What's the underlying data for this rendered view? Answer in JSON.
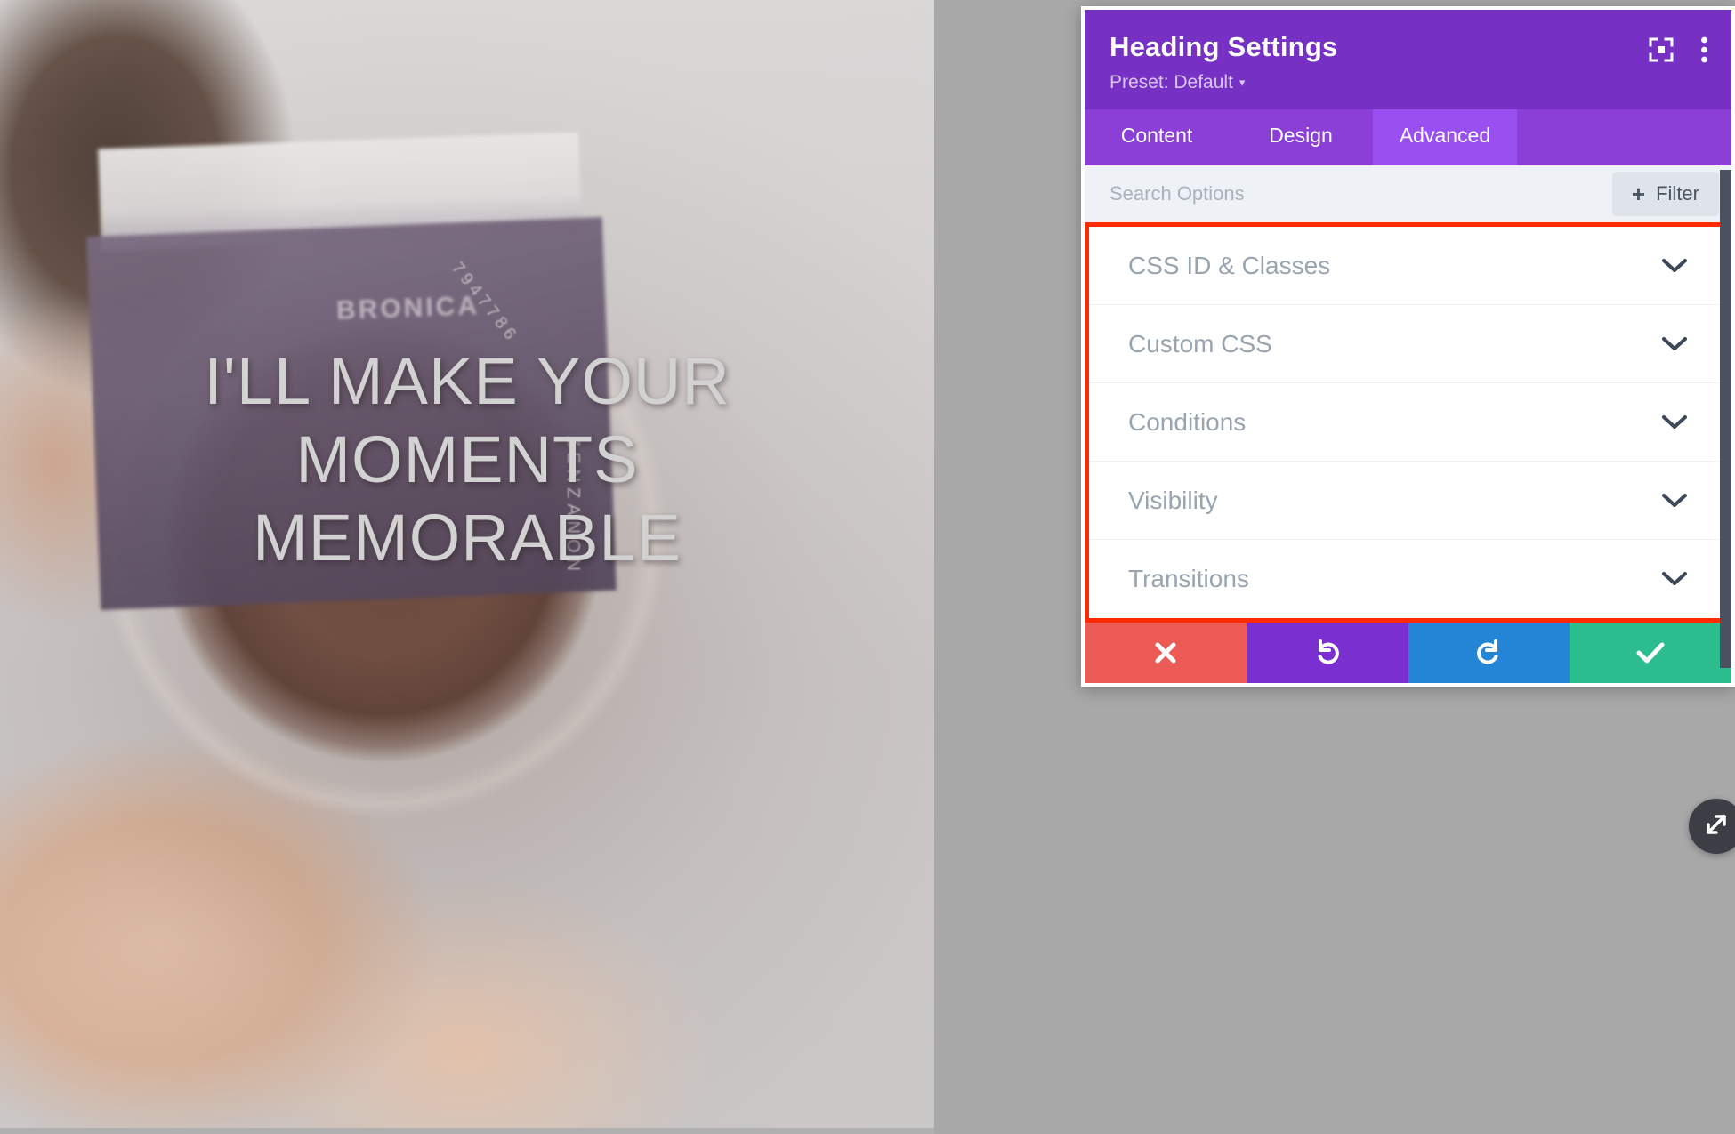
{
  "hero": {
    "heading_line1": "I'LL MAKE YOUR",
    "heading_line2": "MOMENTS",
    "heading_line3": "MEMORABLE",
    "camera_brand_text": "BRONICA",
    "lens_serial": "7947786",
    "lens_brand": "ZENZANON",
    "heading_color": "#d2d2d2"
  },
  "modal": {
    "title": "Heading Settings",
    "preset_label": "Preset: Default",
    "preset_caret": "▾",
    "header_icons": [
      {
        "name": "focus-target-icon"
      },
      {
        "name": "more-vertical-icon"
      }
    ],
    "header_bg": "#7630c3",
    "tabs": [
      {
        "label": "Content",
        "active": false
      },
      {
        "label": "Design",
        "active": false
      },
      {
        "label": "Advanced",
        "active": true
      }
    ],
    "tab_bg": "#8b3fd6",
    "tab_active_bg": "#9a4ff0",
    "search": {
      "value": "",
      "placeholder": "Search Options",
      "filter_label": "Filter",
      "filter_plus": "+"
    },
    "highlight_color": "#ff2a00",
    "options": [
      {
        "label": "CSS ID & Classes",
        "expanded": false
      },
      {
        "label": "Custom CSS",
        "expanded": false
      },
      {
        "label": "Conditions",
        "expanded": false
      },
      {
        "label": "Visibility",
        "expanded": false
      },
      {
        "label": "Transitions",
        "expanded": false
      }
    ],
    "actions": [
      {
        "name": "discard-button",
        "icon": "close-icon",
        "color": "#eb5a54"
      },
      {
        "name": "undo-button",
        "icon": "undo-icon",
        "color": "#7a30d0"
      },
      {
        "name": "redo-button",
        "icon": "redo-icon",
        "color": "#2484d6"
      },
      {
        "name": "save-button",
        "icon": "check-icon",
        "color": "#2bbd8e"
      }
    ]
  },
  "resize_handle": {
    "name": "resize-handle",
    "icon": "diagonal-resize-icon"
  }
}
